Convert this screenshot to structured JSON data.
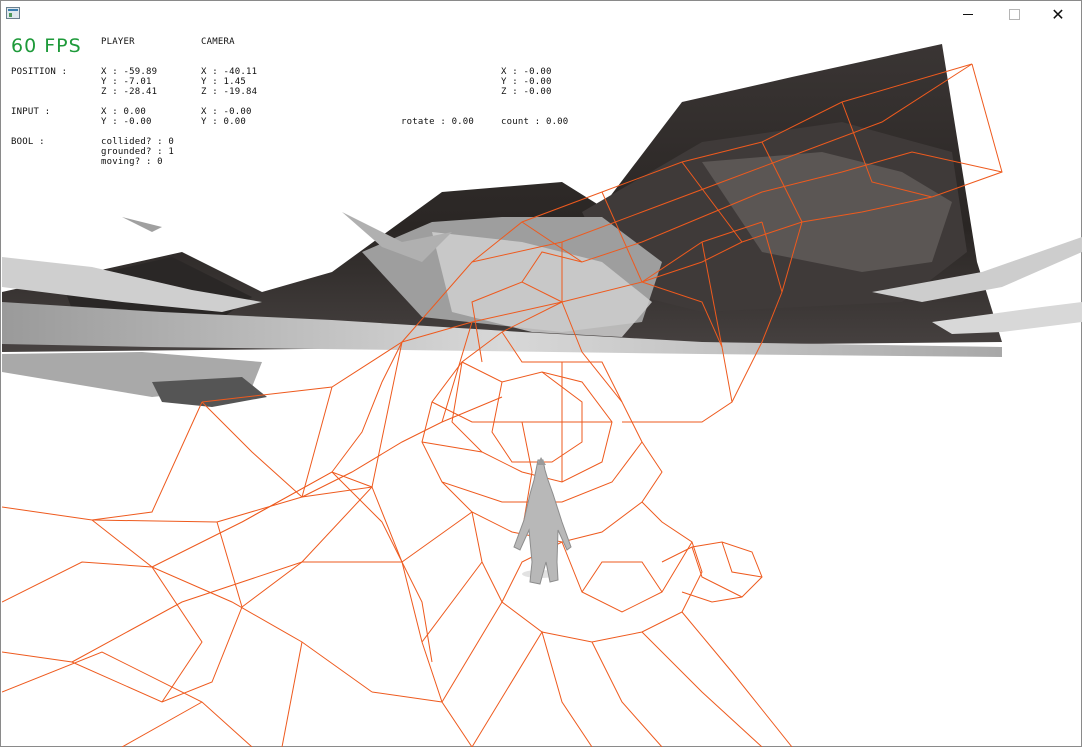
{
  "hud": {
    "fps": "60 FPS",
    "headers": {
      "player": "PLAYER",
      "camera": "CAMERA"
    },
    "labels": {
      "position": "POSITION :",
      "input": "INPUT :",
      "bool": "BOOL :"
    },
    "player_position": {
      "x": "X : -59.89",
      "y": "Y : -7.01",
      "z": "Z : -28.41"
    },
    "camera_position": {
      "x": "X : -40.11",
      "y": "Y : 1.45",
      "z": "Z : -19.84"
    },
    "extra_position": {
      "x": "X : -0.00",
      "y": "Y : -0.00",
      "z": "Z : -0.00"
    },
    "player_input": {
      "x": "X : 0.00",
      "y": "Y : -0.00"
    },
    "camera_input": {
      "x": "X : -0.00",
      "y": "Y : 0.00"
    },
    "rotate": "rotate : 0.00",
    "count": "count : 0.00",
    "bools": {
      "collided": "collided? : 0",
      "grounded": "grounded? : 1",
      "moving": "moving? : 0"
    }
  },
  "colors": {
    "fps_text": "#1e9a3a",
    "wireframe": "#ee5a1e",
    "background": "#ffffff",
    "terrain_dark": "#2f2b2a",
    "terrain_light": "#bdbdbd",
    "character": "#b8b8b8"
  },
  "icons": {
    "app": "app-window-icon",
    "minimize": "minimize-icon",
    "maximize": "maximize-icon",
    "close": "close-icon"
  }
}
